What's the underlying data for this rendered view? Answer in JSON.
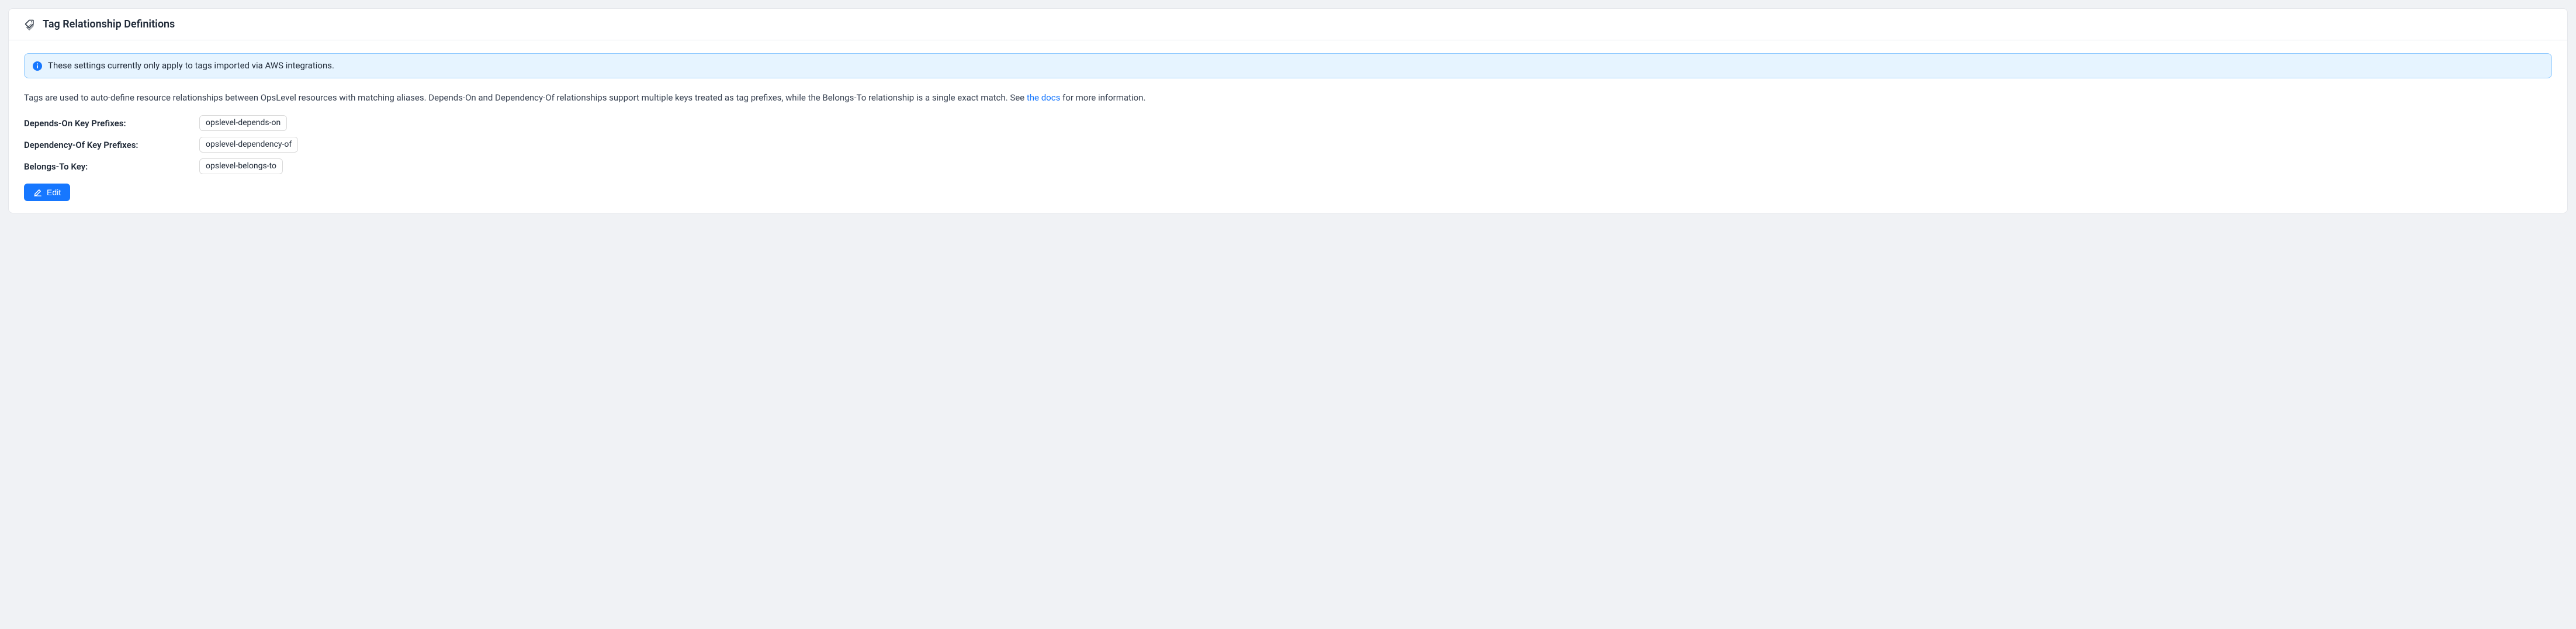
{
  "card": {
    "title": "Tag Relationship Definitions"
  },
  "alert": {
    "text": "These settings currently only apply to tags imported via AWS integrations."
  },
  "description": {
    "pre": "Tags are used to auto-define resource relationships between OpsLevel resources with matching aliases. Depends-On and Dependency-Of relationships support multiple keys treated as tag prefixes, while the Belongs-To relationship is a single exact match. See ",
    "link_text": "the docs",
    "post": " for more information."
  },
  "definitions": [
    {
      "label": "Depends-On Key Prefixes:",
      "value": "opslevel-depends-on"
    },
    {
      "label": "Dependency-Of Key Prefixes:",
      "value": "opslevel-dependency-of"
    },
    {
      "label": "Belongs-To Key:",
      "value": "opslevel-belongs-to"
    }
  ],
  "edit_button": {
    "label": "Edit"
  }
}
